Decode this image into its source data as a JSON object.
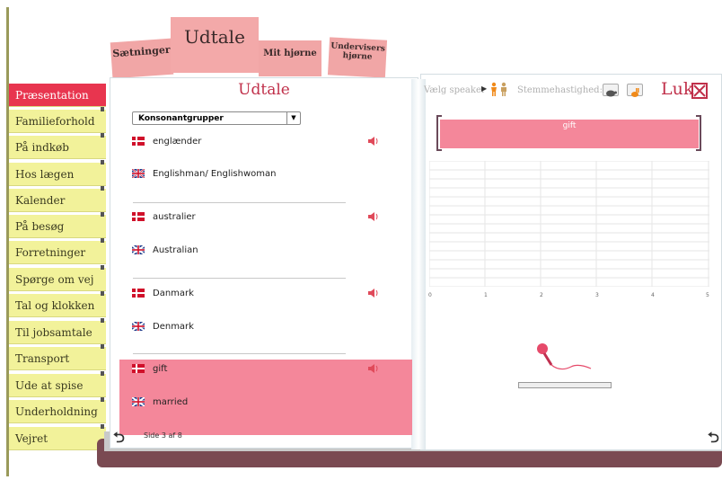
{
  "top_tabs": {
    "saetninger": "Sætninger",
    "udtale": "Udtale",
    "mit_hjorne": "Mit hjørne",
    "undervisers_line1": "Undervisers",
    "undervisers_line2": "hjørne"
  },
  "sidebar": {
    "items": [
      {
        "label": "Præsentation",
        "active": true
      },
      {
        "label": "Familieforhold",
        "active": false
      },
      {
        "label": "På indkøb",
        "active": false
      },
      {
        "label": "Hos lægen",
        "active": false
      },
      {
        "label": "Kalender",
        "active": false
      },
      {
        "label": "På besøg",
        "active": false
      },
      {
        "label": "Forretninger",
        "active": false
      },
      {
        "label": "Spørge om vej",
        "active": false
      },
      {
        "label": "Tal og klokken",
        "active": false
      },
      {
        "label": "Til jobsamtale",
        "active": false
      },
      {
        "label": "Transport",
        "active": false
      },
      {
        "label": "Ude at spise",
        "active": false
      },
      {
        "label": "Underholdning",
        "active": false
      },
      {
        "label": "Vejret",
        "active": false
      }
    ]
  },
  "left_page": {
    "title": "Udtale",
    "category_select": "Konsonantgrupper",
    "entries": [
      {
        "danish": "englænder",
        "english": "Englishman/ Englishwoman",
        "selected": false
      },
      {
        "danish": "australier",
        "english": "Australian",
        "selected": false
      },
      {
        "danish": "Danmark",
        "english": "Denmark",
        "selected": false
      },
      {
        "danish": "gift",
        "english": "married",
        "selected": true
      }
    ],
    "pager": "Side 3 af 8"
  },
  "right_page": {
    "speaker_label": "Vælg speaker",
    "speed_label": "Stemmehastighed:",
    "close_label": "Luk",
    "current_word": "gift",
    "x_axis_ticks": [
      "0",
      "1",
      "2",
      "3",
      "4",
      "5"
    ],
    "recording_level": 0
  },
  "colors": {
    "accent": "#e8354f",
    "highlight": "#f4879a",
    "sidebar": "#f2f29a",
    "tab": "#f3a9a9"
  },
  "icons": [
    "flag-dk-icon",
    "flag-uk-icon",
    "speaker-icon",
    "microphone-icon",
    "turtle-icon",
    "rabbit-icon",
    "close-icon",
    "arrow-left-icon",
    "arrow-right-icon"
  ]
}
